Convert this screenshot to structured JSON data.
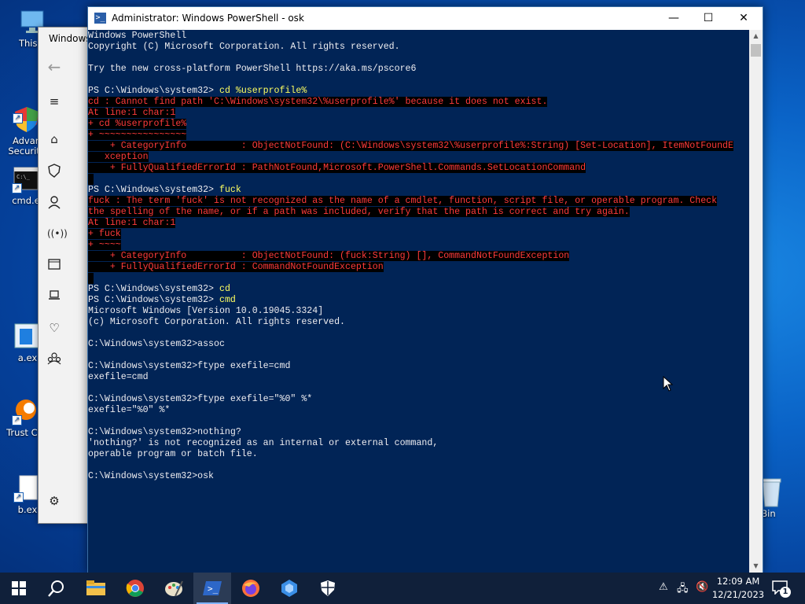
{
  "desktop": {
    "icons": [
      {
        "label": "This P"
      },
      {
        "label": "Advan\nSecurity"
      },
      {
        "label": "cmd.e"
      },
      {
        "label": "a.ex"
      },
      {
        "label": "Trust Cle"
      },
      {
        "label": "b.ex"
      }
    ],
    "recycle_bin": "cle Bin"
  },
  "security_window": {
    "title": "Windows"
  },
  "powershell": {
    "title": "Administrator: Windows PowerShell - osk",
    "controls": {
      "minimize": "—",
      "maximize": "☐",
      "close": "✕"
    },
    "lines": [
      {
        "t": "Windows PowerShell",
        "k": "n"
      },
      {
        "t": "Copyright (C) Microsoft Corporation. All rights reserved.",
        "k": "n"
      },
      {
        "t": "",
        "k": "n"
      },
      {
        "t": "Try the new cross-platform PowerShell https://aka.ms/pscore6",
        "k": "n"
      },
      {
        "t": "",
        "k": "n"
      },
      {
        "p": "PS C:\\Windows\\system32> ",
        "c": "cd %userprofile%",
        "k": "cmd"
      },
      {
        "t": "cd : Cannot find path 'C:\\Windows\\system32\\%userprofile%' because it does not exist.",
        "k": "err"
      },
      {
        "t": "At line:1 char:1",
        "k": "err"
      },
      {
        "t": "+ cd %userprofile%",
        "k": "err"
      },
      {
        "t": "+ ~~~~~~~~~~~~~~~~",
        "k": "err"
      },
      {
        "t": "    + CategoryInfo          : ObjectNotFound: (C:\\Windows\\system32\\%userprofile%:String) [Set-Location], ItemNotFoundE",
        "k": "err"
      },
      {
        "t": "   xception",
        "k": "err"
      },
      {
        "t": "    + FullyQualifiedErrorId : PathNotFound,Microsoft.PowerShell.Commands.SetLocationCommand",
        "k": "err"
      },
      {
        "t": "",
        "k": "errgap"
      },
      {
        "p": "PS C:\\Windows\\system32> ",
        "c": "fuck",
        "k": "cmd"
      },
      {
        "t": "fuck : The term 'fuck' is not recognized as the name of a cmdlet, function, script file, or operable program. Check",
        "k": "err"
      },
      {
        "t": "the spelling of the name, or if a path was included, verify that the path is correct and try again.",
        "k": "err"
      },
      {
        "t": "At line:1 char:1",
        "k": "err"
      },
      {
        "t": "+ fuck",
        "k": "err"
      },
      {
        "t": "+ ~~~~",
        "k": "err"
      },
      {
        "t": "    + CategoryInfo          : ObjectNotFound: (fuck:String) [], CommandNotFoundException",
        "k": "err"
      },
      {
        "t": "    + FullyQualifiedErrorId : CommandNotFoundException",
        "k": "err"
      },
      {
        "t": "",
        "k": "errgap"
      },
      {
        "p": "PS C:\\Windows\\system32> ",
        "c": "cd",
        "k": "cmd"
      },
      {
        "p": "PS C:\\Windows\\system32> ",
        "c": "cmd",
        "k": "cmd"
      },
      {
        "t": "Microsoft Windows [Version 10.0.19045.3324]",
        "k": "n"
      },
      {
        "t": "(c) Microsoft Corporation. All rights reserved.",
        "k": "n"
      },
      {
        "t": "",
        "k": "n"
      },
      {
        "t": "C:\\Windows\\system32>assoc",
        "k": "n"
      },
      {
        "t": "",
        "k": "n"
      },
      {
        "t": "C:\\Windows\\system32>ftype exefile=cmd",
        "k": "n"
      },
      {
        "t": "exefile=cmd",
        "k": "n"
      },
      {
        "t": "",
        "k": "n"
      },
      {
        "t": "C:\\Windows\\system32>ftype exefile=\"%0\" %*",
        "k": "n"
      },
      {
        "t": "exefile=\"%0\" %*",
        "k": "n"
      },
      {
        "t": "",
        "k": "n"
      },
      {
        "t": "C:\\Windows\\system32>nothing?",
        "k": "n"
      },
      {
        "t": "'nothing?' is not recognized as an internal or external command,",
        "k": "n"
      },
      {
        "t": "operable program or batch file.",
        "k": "n"
      },
      {
        "t": "",
        "k": "n"
      },
      {
        "t": "C:\\Windows\\system32>osk",
        "k": "n"
      }
    ]
  },
  "taskbar": {
    "apps": [
      "start-icon",
      "search-icon",
      "file-explorer-icon",
      "chrome-icon",
      "paint-icon",
      "powershell-icon",
      "firefox-icon",
      "app-icon",
      "security-shield-icon"
    ],
    "time": "12:09 AM",
    "date": "12/21/2023",
    "notification_count": "1"
  },
  "colors": {
    "console_bg": "#012456",
    "error_fg": "#ff3b3b",
    "command_fg": "#ffff60"
  }
}
